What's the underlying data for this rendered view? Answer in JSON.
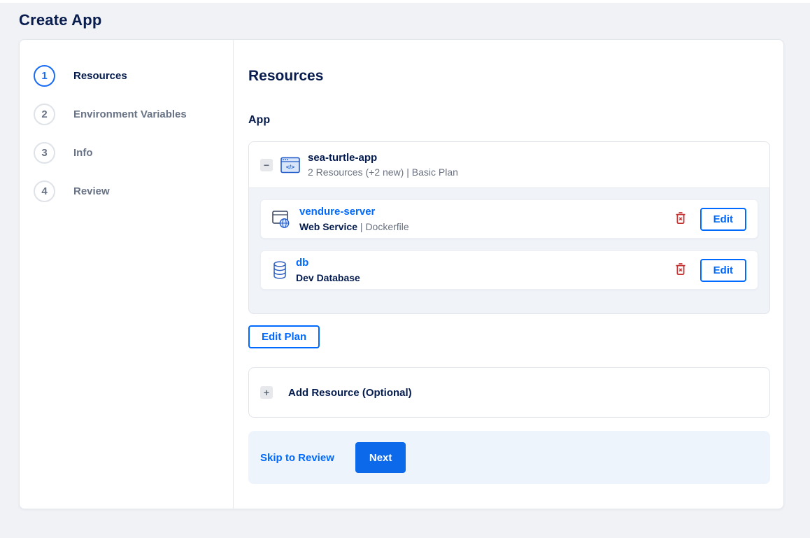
{
  "page": {
    "title": "Create App"
  },
  "stepper": {
    "items": [
      {
        "num": "1",
        "label": "Resources",
        "active": true
      },
      {
        "num": "2",
        "label": "Environment Variables",
        "active": false
      },
      {
        "num": "3",
        "label": "Info",
        "active": false
      },
      {
        "num": "4",
        "label": "Review",
        "active": false
      }
    ]
  },
  "content": {
    "heading": "Resources",
    "section_label": "App",
    "app": {
      "collapse_glyph": "−",
      "icon": "app-window-code-icon",
      "name": "sea-turtle-app",
      "meta": "2 Resources (+2 new) | Basic Plan"
    },
    "resources": [
      {
        "icon": "web-service-icon",
        "name": "vendure-server",
        "type": "Web Service",
        "sep": " | ",
        "detail": "Dockerfile",
        "delete_icon": "trash-icon",
        "edit_label": "Edit"
      },
      {
        "icon": "database-icon",
        "name": "db",
        "type": "Dev Database",
        "sep": "",
        "detail": "",
        "delete_icon": "trash-icon",
        "edit_label": "Edit"
      }
    ],
    "edit_plan_label": "Edit Plan",
    "add_resource": {
      "glyph": "+",
      "label": "Add Resource (Optional)"
    },
    "footer": {
      "skip_label": "Skip to Review",
      "next_label": "Next"
    }
  },
  "colors": {
    "accent_blue": "#0069ff",
    "primary_button_blue": "#0b69ea",
    "dark_navy_text": "#031b4e",
    "muted_gray_text": "#6b7280",
    "danger_red": "#c43030",
    "page_background": "#f0f2f6",
    "inner_panel_background": "#f0f3f8",
    "footer_background": "#eef4fb"
  }
}
